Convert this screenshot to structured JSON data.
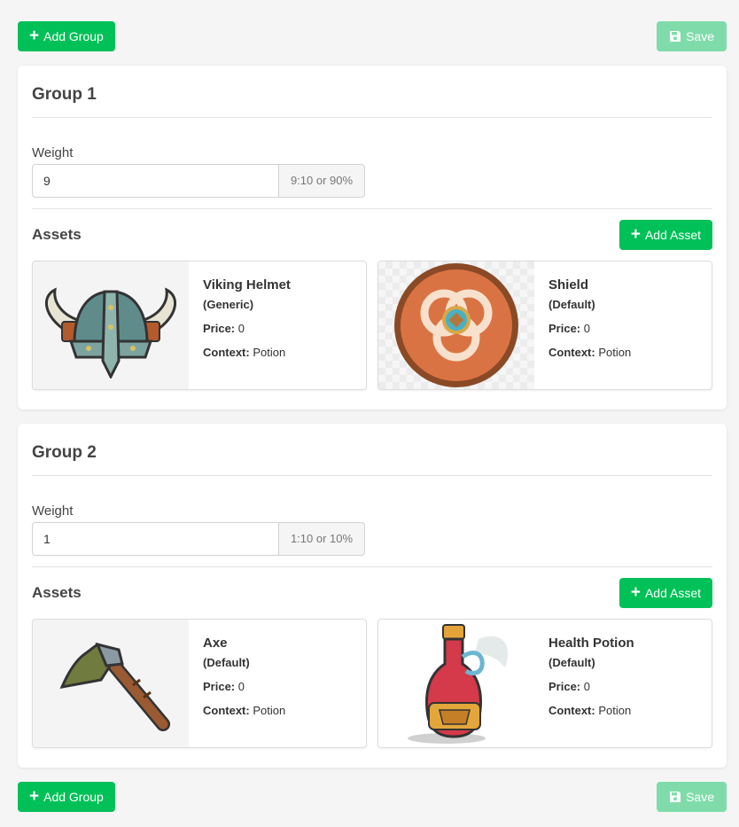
{
  "toolbar": {
    "add_group_label": "Add Group",
    "save_label": "Save"
  },
  "groups": [
    {
      "title": "Group 1",
      "weight_label": "Weight",
      "weight_value": "9",
      "weight_ratio": "9:10 or 90%",
      "assets_label": "Assets",
      "add_asset_label": "Add Asset",
      "assets": [
        {
          "name": "Viking Helmet",
          "type": "(Generic)",
          "price_label": "Price:",
          "price": "0",
          "context_label": "Context:",
          "context": "Potion",
          "icon": "viking-helmet-icon"
        },
        {
          "name": "Shield",
          "type": "(Default)",
          "price_label": "Price:",
          "price": "0",
          "context_label": "Context:",
          "context": "Potion",
          "icon": "shield-icon"
        }
      ]
    },
    {
      "title": "Group 2",
      "weight_label": "Weight",
      "weight_value": "1",
      "weight_ratio": "1:10 or 10%",
      "assets_label": "Assets",
      "add_asset_label": "Add Asset",
      "assets": [
        {
          "name": "Axe",
          "type": "(Default)",
          "price_label": "Price:",
          "price": "0",
          "context_label": "Context:",
          "context": "Potion",
          "icon": "axe-icon"
        },
        {
          "name": "Health Potion",
          "type": "(Default)",
          "price_label": "Price:",
          "price": "0",
          "context_label": "Context:",
          "context": "Potion",
          "icon": "health-potion-icon"
        }
      ]
    }
  ],
  "colors": {
    "primary_green": "#00c058",
    "save_disabled": "#7fdcaa",
    "background": "#f5f5f5"
  }
}
